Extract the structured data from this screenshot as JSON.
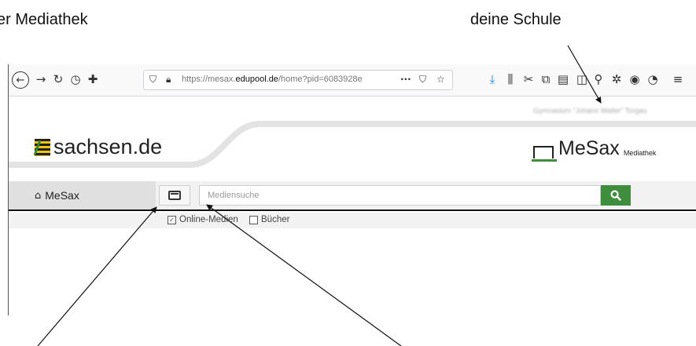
{
  "annotations": {
    "left_label": "er Mediathek",
    "right_label": "deine Schule"
  },
  "browser": {
    "url_prefix": "https://mesax.",
    "url_domain": "edupool.de",
    "url_suffix": "/home?pid=6083928e",
    "page_actions_label": "···",
    "school_name": "Gymnasium \"Johann Walter\" Torgau"
  },
  "header": {
    "left_logo_text": "sachsen.de",
    "right_logo_title": "MeSax",
    "right_logo_subtitle": "Mediathek"
  },
  "nav": {
    "home_label": "MeSax",
    "search_placeholder": "Mediensuche",
    "search_value": ""
  },
  "filters": [
    {
      "label": "Online-Medien",
      "checked": true
    },
    {
      "label": "Bücher",
      "checked": false
    }
  ],
  "colors": {
    "accent_green": "#3e8e3e",
    "flag_yellow": "#f0c300"
  }
}
